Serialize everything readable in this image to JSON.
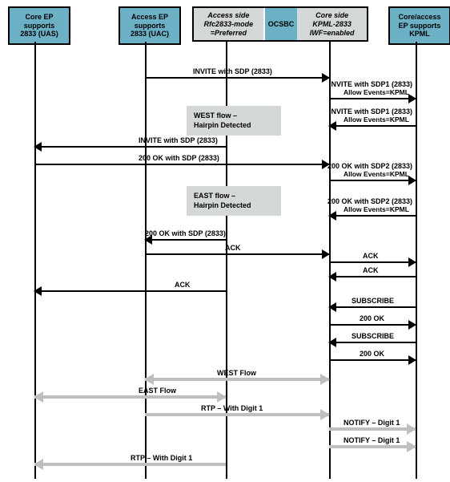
{
  "actors": {
    "uas": {
      "label": "Core EP\nsupports\n2833 (UAS)"
    },
    "uac": {
      "label": "Access EP\nsupports\n2833 (UAC)"
    },
    "ocsbc_left": {
      "label": "Access side\nRfc2833-mode\n=Preferred"
    },
    "ocsbc_mid": {
      "label": "OCSBC"
    },
    "ocsbc_right": {
      "label": "Core side\nKPML-2833\nIWF=enabled"
    },
    "kpml": {
      "label": "Core/access\nEP supports\nKPML"
    }
  },
  "notes": {
    "west": {
      "line1": "WEST flow –",
      "line2": "Hairpin Detected"
    },
    "east": {
      "line1": "EAST flow –",
      "line2": "Hairpin Detected"
    }
  },
  "msgs": {
    "m1": {
      "t": "INVITE with SDP (2833)"
    },
    "m2": {
      "t": "INVITE with SDP1 (2833)",
      "s": "Allow Events=KPML"
    },
    "m3": {
      "t": "INVITE with SDP1 (2833)",
      "s": "Allow Events=KPML"
    },
    "m4": {
      "t": "INVITE with SDP (2833)"
    },
    "m5": {
      "t": "200 OK with SDP (2833)"
    },
    "m6": {
      "t": "200 OK with SDP2 (2833)",
      "s": "Allow Events=KPML"
    },
    "m7": {
      "t": "200 OK with SDP2 (2833)",
      "s": "Allow Events=KPML"
    },
    "m8": {
      "t": "200 OK with SDP (2833)"
    },
    "m9": {
      "t": "ACK"
    },
    "m10": {
      "t": "ACK"
    },
    "m11": {
      "t": "ACK"
    },
    "m12": {
      "t": "ACK"
    },
    "m13": {
      "t": "SUBSCRIBE"
    },
    "m14": {
      "t": "200 OK"
    },
    "m15": {
      "t": "SUBSCRIBE"
    },
    "m16": {
      "t": "200 OK"
    },
    "m17": {
      "t": "WEST Flow"
    },
    "m18": {
      "t": "EAST Flow"
    },
    "m19": {
      "t": "RTP – With Digit 1"
    },
    "m20": {
      "t": "NOTIFY – Digit 1"
    },
    "m21": {
      "t": "NOTIFY – Digit 1"
    },
    "m22": {
      "t": "RTP – With Digit 1"
    }
  },
  "lanes": {
    "uas": 43,
    "uac": 181,
    "ocsbc_l": 282,
    "ocsbc_r": 411,
    "kpml": 519
  },
  "colors": {
    "actor": "#6bb0c4",
    "note": "#d5d8d8",
    "gray": "#bfbfbf"
  }
}
